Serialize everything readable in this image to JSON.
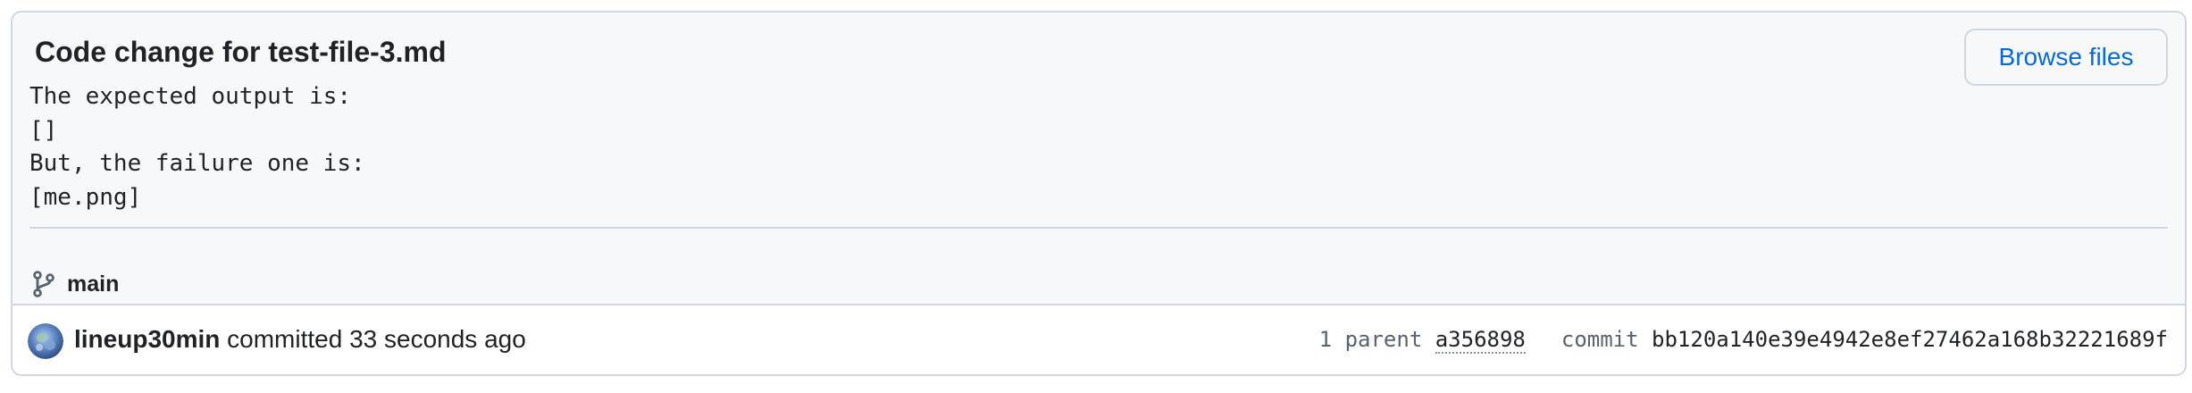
{
  "commit": {
    "title": "Code change for test-file-3.md",
    "browse_label": "Browse files",
    "description_lines": [
      "The expected output is:",
      "[]",
      "But, the failure one is:",
      "[me.png]"
    ],
    "branch": "main",
    "branch_icon": "git-branch-icon",
    "author": "lineup30min",
    "author_action": "committed",
    "time_ago": "33 seconds ago",
    "parent_count_label": "1 parent",
    "parent_sha": "a356898",
    "commit_label": "commit",
    "sha": "bb120a140e39e4942e8ef27462a168b32221689f",
    "avatar_icon": "avatar"
  },
  "colors": {
    "header_bg": "#f6f8fa",
    "border": "#d0d7de",
    "link": "#0969da",
    "muted": "#59636e",
    "text": "#1f2328"
  }
}
